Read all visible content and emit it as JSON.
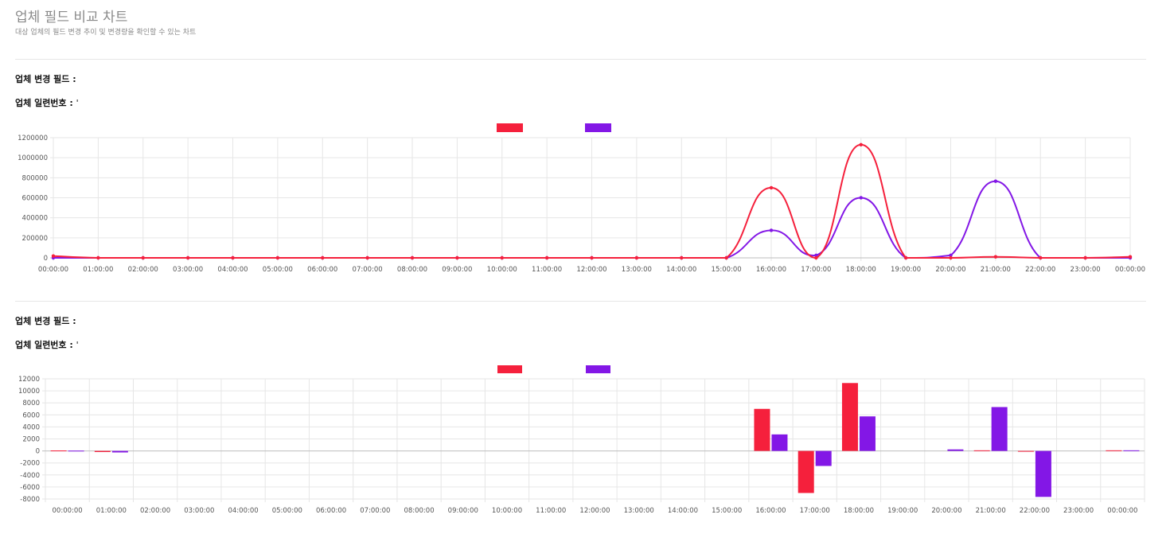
{
  "page": {
    "title": "업체 필드 비교 차트",
    "subtitle": "대상 업체의 필드 변경 추이 및 변경량을 확인할 수 있는 차트"
  },
  "panels": [
    {
      "field_label": "업체 변경 필드 :",
      "field_value": "",
      "serial_label": "업체 일련번호 :",
      "serial_value": "'"
    },
    {
      "field_label": "업체 변경 필드 :",
      "field_value": "",
      "serial_label": "업체 일련번호 :",
      "serial_value": "'"
    }
  ],
  "colors": {
    "series_a": "#f5203c",
    "series_b": "#8317e6",
    "grid": "#e6e6e6"
  },
  "chart_data": [
    {
      "type": "line",
      "categories": [
        "00:00:00",
        "01:00:00",
        "02:00:00",
        "03:00:00",
        "04:00:00",
        "05:00:00",
        "06:00:00",
        "07:00:00",
        "08:00:00",
        "09:00:00",
        "10:00:00",
        "11:00:00",
        "12:00:00",
        "13:00:00",
        "14:00:00",
        "15:00:00",
        "16:00:00",
        "17:00:00",
        "18:00:00",
        "19:00:00",
        "20:00:00",
        "21:00:00",
        "22:00:00",
        "23:00:00",
        "00:00:00"
      ],
      "series": [
        {
          "values": [
            18000,
            0,
            0,
            0,
            0,
            0,
            0,
            0,
            0,
            0,
            0,
            0,
            0,
            0,
            0,
            0,
            700000,
            0,
            1130000,
            0,
            0,
            10000,
            0,
            0,
            10000
          ]
        },
        {
          "values": [
            0,
            0,
            0,
            0,
            0,
            0,
            0,
            0,
            0,
            0,
            0,
            0,
            0,
            0,
            0,
            0,
            275000,
            25000,
            600000,
            0,
            25000,
            765000,
            0,
            0,
            0
          ]
        }
      ],
      "ylim": [
        0,
        1200000
      ],
      "yticks": [
        0,
        200000,
        400000,
        600000,
        800000,
        1000000,
        1200000
      ],
      "grid": true,
      "legend": "top-center"
    },
    {
      "type": "bar",
      "categories": [
        "00:00:00",
        "01:00:00",
        "02:00:00",
        "03:00:00",
        "04:00:00",
        "05:00:00",
        "06:00:00",
        "07:00:00",
        "08:00:00",
        "09:00:00",
        "10:00:00",
        "11:00:00",
        "12:00:00",
        "13:00:00",
        "14:00:00",
        "15:00:00",
        "16:00:00",
        "17:00:00",
        "18:00:00",
        "19:00:00",
        "20:00:00",
        "21:00:00",
        "22:00:00",
        "23:00:00",
        "00:00:00"
      ],
      "series": [
        {
          "values": [
            80,
            -180,
            0,
            0,
            0,
            0,
            0,
            0,
            0,
            0,
            0,
            0,
            0,
            0,
            0,
            0,
            7000,
            -7000,
            11300,
            0,
            0,
            100,
            -100,
            0,
            100
          ]
        },
        {
          "values": [
            50,
            -250,
            0,
            0,
            0,
            0,
            0,
            0,
            0,
            0,
            0,
            0,
            0,
            0,
            0,
            0,
            2750,
            -2500,
            5750,
            0,
            250,
            7300,
            -7650,
            0,
            100
          ]
        }
      ],
      "ylim": [
        -8000,
        12000
      ],
      "yticks": [
        -8000,
        -6000,
        -4000,
        -2000,
        0,
        2000,
        4000,
        6000,
        8000,
        10000,
        12000
      ],
      "grid": true,
      "legend": "top-center"
    }
  ]
}
